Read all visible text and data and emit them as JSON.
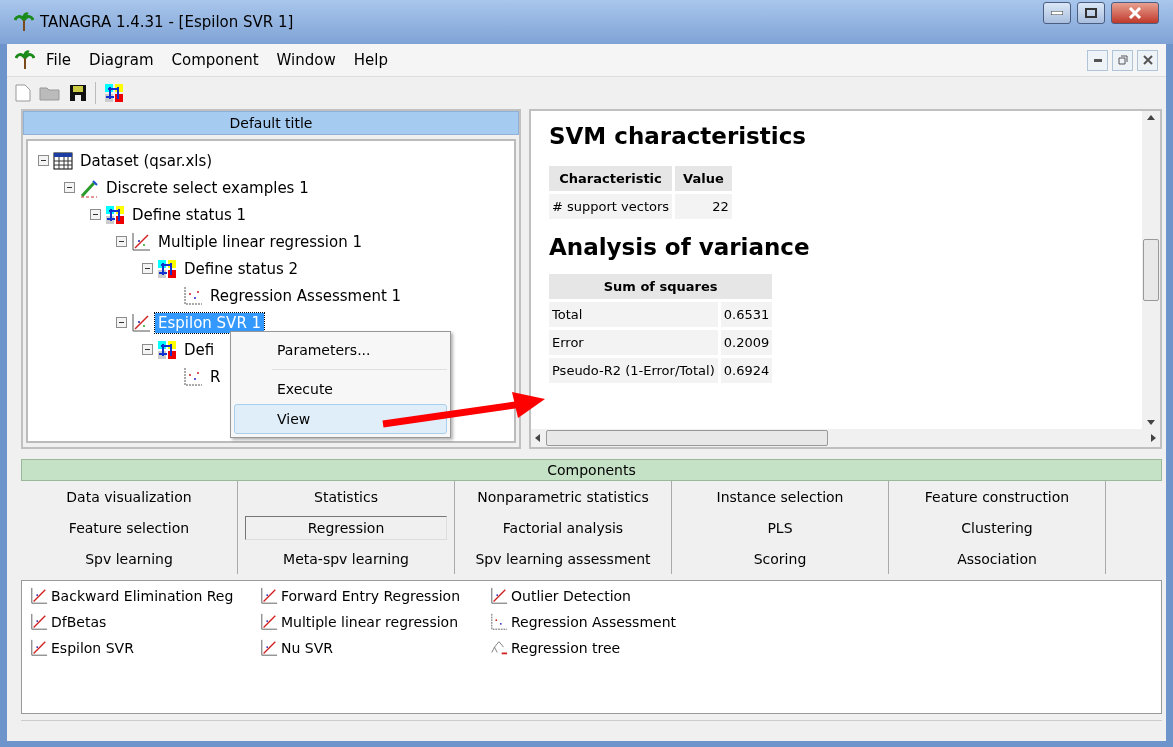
{
  "window": {
    "title": "TANAGRA 1.4.31 - [Espilon SVR 1]"
  },
  "menu": [
    "File",
    "Diagram",
    "Component",
    "Window",
    "Help"
  ],
  "diagram": {
    "title": "Default title",
    "tree": [
      {
        "label": "Dataset (qsar.xls)",
        "kind": "dataset",
        "expanded": true,
        "selected": false,
        "children": [
          {
            "label": "Discrete select examples 1",
            "kind": "filter",
            "expanded": true,
            "selected": false,
            "children": [
              {
                "label": "Define status 1",
                "kind": "status",
                "expanded": true,
                "selected": false,
                "children": [
                  {
                    "label": "Multiple linear regression 1",
                    "kind": "regression",
                    "expanded": true,
                    "selected": false,
                    "children": [
                      {
                        "label": "Define status 2",
                        "kind": "status",
                        "expanded": true,
                        "selected": false,
                        "children": [
                          {
                            "label": "Regression Assessment 1",
                            "kind": "assessment",
                            "selected": false
                          }
                        ]
                      }
                    ]
                  },
                  {
                    "label": "Espilon SVR 1",
                    "kind": "regression",
                    "expanded": true,
                    "selected": true,
                    "children": [
                      {
                        "label": "Defi",
                        "kind": "status",
                        "expanded": true,
                        "selected": false,
                        "children": [
                          {
                            "label": "R",
                            "kind": "assessment",
                            "selected": false
                          }
                        ]
                      }
                    ]
                  }
                ]
              }
            ]
          }
        ]
      }
    ]
  },
  "context_menu": {
    "items": [
      {
        "label": "Parameters...",
        "selected": false,
        "divider_after": true
      },
      {
        "label": "Execute",
        "selected": false,
        "divider_after": false
      },
      {
        "label": "View",
        "selected": true,
        "divider_after": false
      }
    ]
  },
  "report": {
    "sections": [
      {
        "heading": "SVM characteristics",
        "table": {
          "columns": [
            "Characteristic",
            "Value"
          ],
          "rows": [
            [
              "# support vectors",
              "22"
            ]
          ]
        }
      },
      {
        "heading": "Analysis of variance",
        "table": {
          "title": "Sum of squares",
          "rows": [
            [
              "Total",
              "0.6531"
            ],
            [
              "Error",
              "0.2009"
            ],
            [
              "Pseudo-R2 (1-Error/Total)",
              "0.6924"
            ]
          ]
        }
      }
    ]
  },
  "components": {
    "title": "Components",
    "tabs": [
      {
        "label": "Data visualization",
        "selected": false
      },
      {
        "label": "Statistics",
        "selected": false
      },
      {
        "label": "Nonparametric statistics",
        "selected": false
      },
      {
        "label": "Instance selection",
        "selected": false
      },
      {
        "label": "Feature construction",
        "selected": false
      },
      {
        "label": "Feature selection",
        "selected": false
      },
      {
        "label": "Regression",
        "selected": true
      },
      {
        "label": "Factorial analysis",
        "selected": false
      },
      {
        "label": "PLS",
        "selected": false
      },
      {
        "label": "Clustering",
        "selected": false
      },
      {
        "label": "Spv learning",
        "selected": false
      },
      {
        "label": "Meta-spv learning",
        "selected": false
      },
      {
        "label": "Spv learning assessment",
        "selected": false
      },
      {
        "label": "Scoring",
        "selected": false
      },
      {
        "label": "Association",
        "selected": false
      }
    ],
    "items": [
      {
        "label": "Backward Elimination Reg",
        "kind": "chart"
      },
      {
        "label": "Forward Entry Regression",
        "kind": "chart"
      },
      {
        "label": "Outlier Detection",
        "kind": "chart"
      },
      {
        "label": "DfBetas",
        "kind": "chart"
      },
      {
        "label": "Multiple linear regression",
        "kind": "chart"
      },
      {
        "label": "Regression Assessment",
        "kind": "scatter"
      },
      {
        "label": "Espilon SVR",
        "kind": "chart"
      },
      {
        "label": "Nu SVR",
        "kind": "chart"
      },
      {
        "label": "Regression tree",
        "kind": "tree"
      }
    ]
  }
}
